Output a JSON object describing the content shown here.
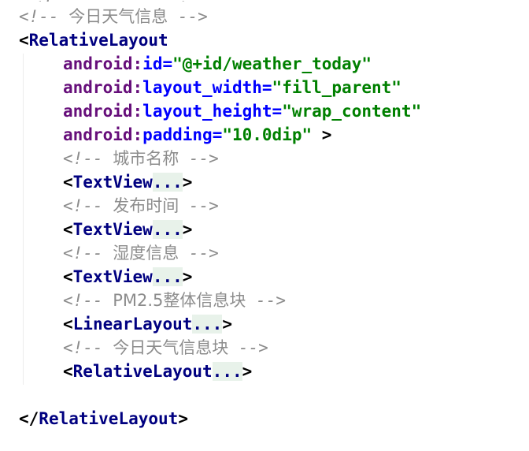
{
  "code": {
    "top_peek": "<!-- ...... -->",
    "comment_weather_today": "今日天气信息",
    "relative_layout_tag": "RelativeLayout",
    "attributes": [
      {
        "ns": "android",
        "name": "id",
        "value": "\"@+id/weather_today\""
      },
      {
        "ns": "android",
        "name": "layout_width",
        "value": "\"fill_parent\""
      },
      {
        "ns": "android",
        "name": "layout_height",
        "value": "\"wrap_content\""
      },
      {
        "ns": "android",
        "name": "padding",
        "value": "\"10.0dip\""
      }
    ],
    "children": [
      {
        "comment": "城市名称",
        "tag": "TextView"
      },
      {
        "comment": "发布时间",
        "tag": "TextView"
      },
      {
        "comment": "湿度信息",
        "tag": "TextView"
      },
      {
        "comment": "PM2.5整体信息块",
        "tag": "LinearLayout"
      },
      {
        "comment": "今日天气信息块",
        "tag": "RelativeLayout"
      }
    ],
    "fold_marker": "...",
    "closing_tag": "RelativeLayout"
  }
}
